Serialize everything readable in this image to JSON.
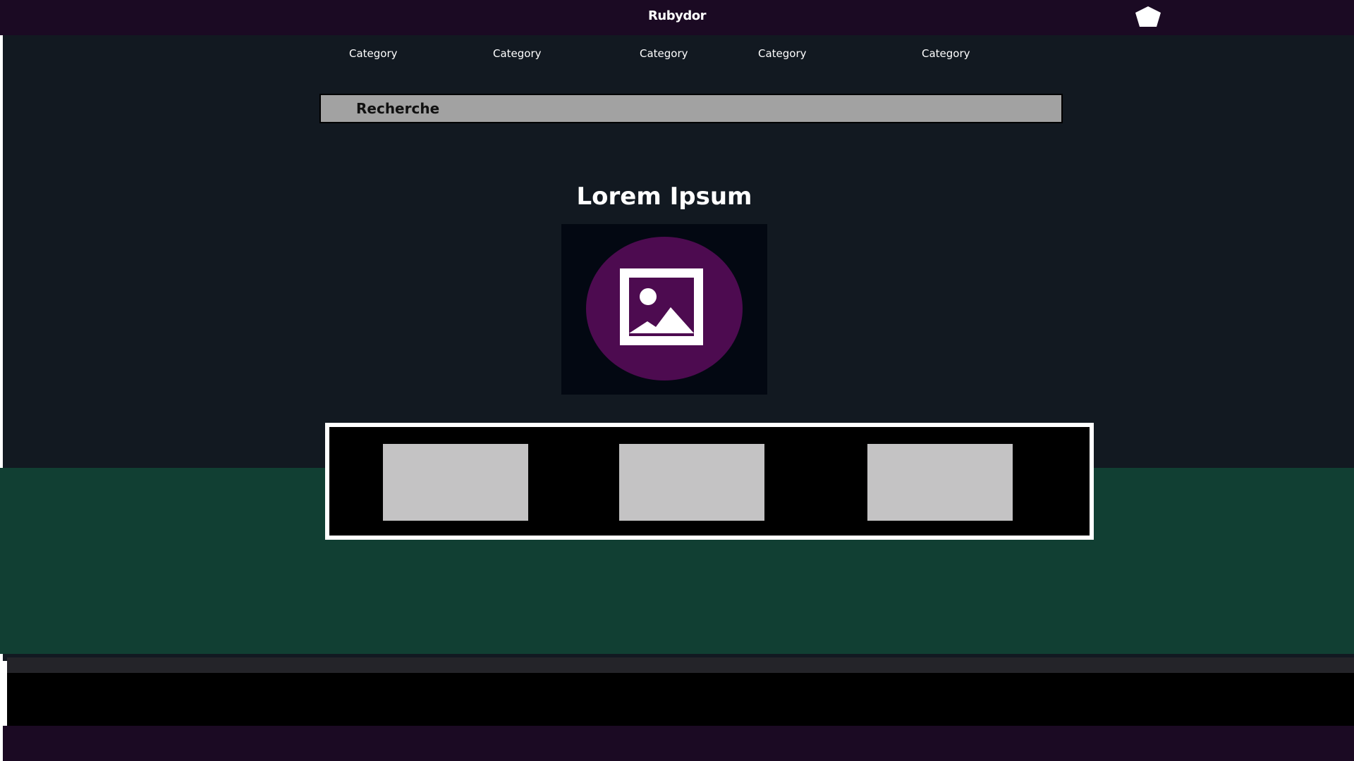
{
  "header": {
    "brand": "Rubydor",
    "logo_icon": "pentagon-gem-icon"
  },
  "nav": {
    "items": [
      {
        "label": "Category"
      },
      {
        "label": "Category"
      },
      {
        "label": "Category"
      },
      {
        "label": "Category"
      },
      {
        "label": "Category"
      }
    ]
  },
  "search": {
    "placeholder": "Recherche"
  },
  "main": {
    "title": "Lorem Ipsum",
    "hero_icon": "image-placeholder-icon"
  },
  "carousel": {
    "items": [
      "thumbnail",
      "thumbnail",
      "thumbnail"
    ]
  },
  "colors": {
    "header_bg": "#1b0a23",
    "main_bg": "#121921",
    "band_green": "#113f33",
    "accent_purple": "#4d0b50",
    "search_bg": "#a2a2a2",
    "thumb_bg": "#c4c3c4"
  }
}
